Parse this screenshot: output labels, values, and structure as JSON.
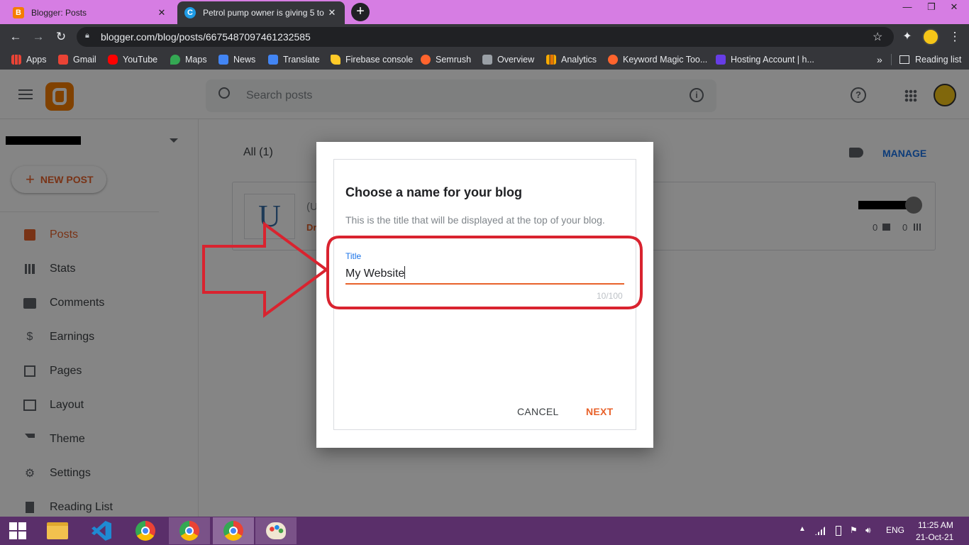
{
  "browser": {
    "tabs": [
      {
        "title": "Blogger: Posts",
        "favicon": "blogger-icon",
        "active": false
      },
      {
        "title": "Petrol pump owner is giving 5 to",
        "favicon": "canva-icon",
        "active": true
      }
    ],
    "new_tab": "+",
    "url": "blogger.com/blog/posts/6675487097461232585",
    "bookmarks": [
      {
        "label": "Apps",
        "icon": "apps-grid-icon",
        "color": "#ea4335"
      },
      {
        "label": "Gmail",
        "icon": "gmail-icon",
        "color": "#ea4335"
      },
      {
        "label": "YouTube",
        "icon": "youtube-icon",
        "color": "#ff0000"
      },
      {
        "label": "Maps",
        "icon": "maps-icon",
        "color": "#34a853"
      },
      {
        "label": "News",
        "icon": "news-icon",
        "color": "#4285f4"
      },
      {
        "label": "Translate",
        "icon": "translate-icon",
        "color": "#4285f4"
      },
      {
        "label": "Firebase console",
        "icon": "firebase-icon",
        "color": "#ffca28"
      },
      {
        "label": "Semrush",
        "icon": "semrush-icon",
        "color": "#ff642d"
      },
      {
        "label": "Overview",
        "icon": "overview-icon",
        "color": "#9aa0a6"
      },
      {
        "label": "Analytics",
        "icon": "analytics-icon",
        "color": "#f9ab00"
      },
      {
        "label": "Keyword Magic Too...",
        "icon": "semrush-icon",
        "color": "#ff642d"
      },
      {
        "label": "Hosting Account | h...",
        "icon": "hostinger-icon",
        "color": "#673de6"
      }
    ],
    "bookmarks_more": "»",
    "reading_list": "Reading list"
  },
  "blogger": {
    "search_placeholder": "Search posts",
    "blog_selector": "",
    "new_post_label": "NEW POST",
    "sidebar": [
      {
        "label": "Posts",
        "icon": "posts-icon",
        "active": true
      },
      {
        "label": "Stats",
        "icon": "stats-icon"
      },
      {
        "label": "Comments",
        "icon": "comments-icon"
      },
      {
        "label": "Earnings",
        "icon": "dollar-icon"
      },
      {
        "label": "Pages",
        "icon": "pages-icon"
      },
      {
        "label": "Layout",
        "icon": "layout-icon"
      },
      {
        "label": "Theme",
        "icon": "theme-icon"
      },
      {
        "label": "Settings",
        "icon": "gear-icon"
      },
      {
        "label": "Reading List",
        "icon": "bookmark-icon"
      }
    ],
    "filter_label": "All (1)",
    "manage_label": "MANAGE",
    "post_thumb_letter": "U",
    "post_title_fragment": "(U",
    "post_status_fragment": "Dr",
    "comment_count": "0",
    "view_count": "0"
  },
  "dialog": {
    "heading": "Choose a name for your blog",
    "description": "This is the title that will be displayed at the top of your blog.",
    "field_label": "Title",
    "field_value": "My Website",
    "char_counter": "10/100",
    "cancel_label": "CANCEL",
    "next_label": "NEXT"
  },
  "taskbar": {
    "apps": [
      {
        "name": "file-explorer-icon"
      },
      {
        "name": "vscode-icon"
      },
      {
        "name": "chrome-icon"
      },
      {
        "name": "chrome-profile-icon"
      },
      {
        "name": "chrome-profile-active-icon"
      },
      {
        "name": "paint-icon"
      }
    ],
    "language": "ENG",
    "time": "11:25 AM",
    "date": "21-Oct-21"
  },
  "colors": {
    "accent": "#e8622b",
    "tab_strip": "#d67de3",
    "taskbar": "#5a2f6a",
    "annotation": "#d9232f",
    "link_blue": "#1a73e8"
  }
}
